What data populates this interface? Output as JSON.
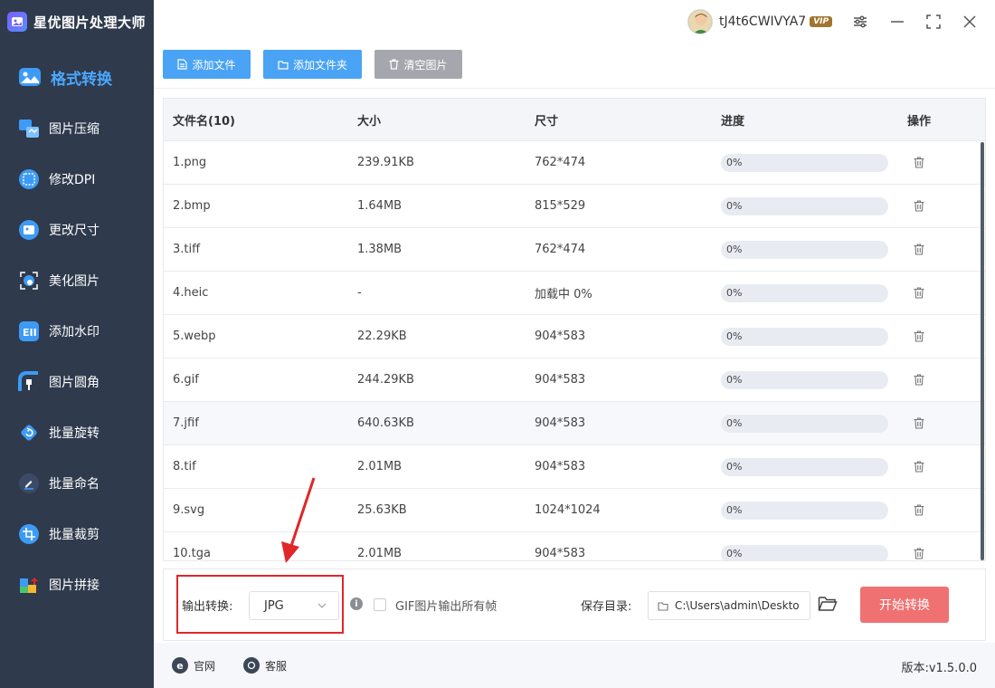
{
  "app": {
    "title": "星优图片处理大师"
  },
  "sidebar": {
    "items": [
      {
        "label": "格式转换",
        "icon": "image-convert-icon",
        "active": true
      },
      {
        "label": "图片压缩",
        "icon": "image-compress-icon"
      },
      {
        "label": "修改DPI",
        "icon": "dpi-icon"
      },
      {
        "label": "更改尺寸",
        "icon": "resize-icon"
      },
      {
        "label": "美化图片",
        "icon": "beautify-icon"
      },
      {
        "label": "添加水印",
        "icon": "watermark-icon"
      },
      {
        "label": "图片圆角",
        "icon": "rounded-corner-icon"
      },
      {
        "label": "批量旋转",
        "icon": "rotate-icon"
      },
      {
        "label": "批量命名",
        "icon": "rename-icon"
      },
      {
        "label": "批量裁剪",
        "icon": "crop-icon"
      },
      {
        "label": "图片拼接",
        "icon": "collage-icon"
      }
    ]
  },
  "user": {
    "name": "tJ4t6CWIVYA7",
    "badge": "VIP"
  },
  "toolbar": {
    "add_file": "添加文件",
    "add_folder": "添加文件夹",
    "clear": "清空图片"
  },
  "table": {
    "headers": {
      "name": "文件名(10)",
      "size": "大小",
      "dimensions": "尺寸",
      "progress": "进度",
      "action": "操作"
    },
    "rows": [
      {
        "name": "1.png",
        "size": "239.91KB",
        "dim": "762*474",
        "progress": "0%"
      },
      {
        "name": "2.bmp",
        "size": "1.64MB",
        "dim": "815*529",
        "progress": "0%"
      },
      {
        "name": "3.tiff",
        "size": "1.38MB",
        "dim": "762*474",
        "progress": "0%"
      },
      {
        "name": "4.heic",
        "size": "-",
        "dim": "加载中 0%",
        "progress": "0%"
      },
      {
        "name": "5.webp",
        "size": "22.29KB",
        "dim": "904*583",
        "progress": "0%"
      },
      {
        "name": "6.gif",
        "size": "244.29KB",
        "dim": "904*583",
        "progress": "0%"
      },
      {
        "name": "7.jfif",
        "size": "640.63KB",
        "dim": "904*583",
        "progress": "0%"
      },
      {
        "name": "8.tif",
        "size": "2.01MB",
        "dim": "904*583",
        "progress": "0%"
      },
      {
        "name": "9.svg",
        "size": "25.63KB",
        "dim": "1024*1024",
        "progress": "0%"
      },
      {
        "name": "10.tga",
        "size": "2.01MB",
        "dim": "904*583",
        "progress": "0%"
      }
    ]
  },
  "config": {
    "output_label": "输出转换:",
    "output_format": "JPG",
    "gif_option": "GIF图片输出所有帧",
    "save_label": "保存目录:",
    "save_path": "C:\\Users\\admin\\Deskto",
    "start": "开始转换"
  },
  "footer": {
    "website": "官网",
    "support": "客服",
    "version": "版本:v1.5.0.0"
  }
}
